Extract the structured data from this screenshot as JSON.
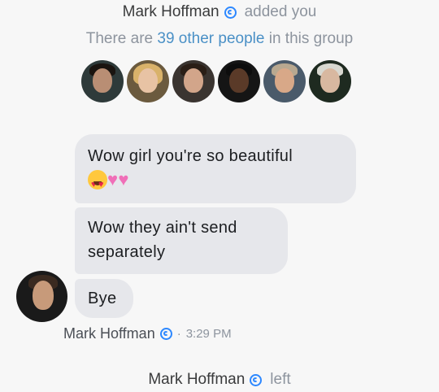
{
  "notice_added": {
    "name": "Mark Hoffman",
    "verb": "added you"
  },
  "group_info": {
    "prefix": "There are ",
    "link": "39 other people",
    "suffix": " in this group"
  },
  "members": [
    {
      "icon": "member-avatar-1"
    },
    {
      "icon": "member-avatar-2"
    },
    {
      "icon": "member-avatar-3"
    },
    {
      "icon": "member-avatar-4"
    },
    {
      "icon": "member-avatar-5"
    },
    {
      "icon": "member-avatar-6"
    }
  ],
  "messages": [
    {
      "text": "Wow girl you're so beautiful",
      "emoji": [
        "heart-eyes-emoji",
        "two-hearts-emoji"
      ]
    },
    {
      "text": "Wow they ain't send separately"
    },
    {
      "text": "Bye"
    }
  ],
  "sender": {
    "name": "Mark Hoffman",
    "separator": "·",
    "time": "3:29 PM"
  },
  "notice_left": {
    "name": "Mark Hoffman",
    "verb": "left"
  },
  "colors": {
    "bubble": "#e6e7eb",
    "link": "#4a90c6",
    "badge": "#2d88ff",
    "background": "#f7f7f7"
  }
}
